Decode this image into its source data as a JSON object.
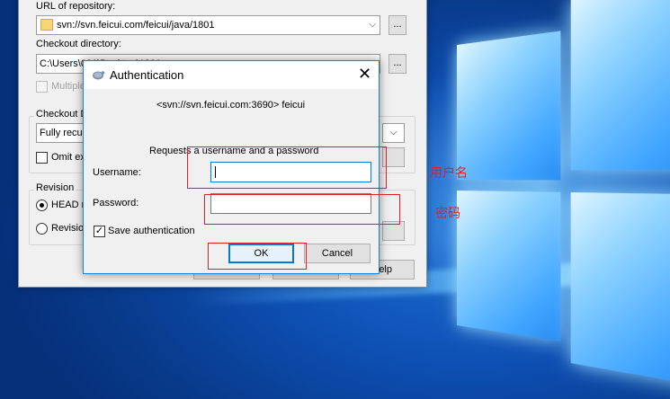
{
  "checkout": {
    "url_label": "URL of repository:",
    "url_value": "svn://svn.feicui.com/feicui/java/1801",
    "browse_button": "...",
    "dir_label": "Checkout directory:",
    "dir_value": "C:\\Users\\001\\Desktop\\1801",
    "multiple_label": "Multiple",
    "depth_label": "Checkout D",
    "depth_value": "Fully recur",
    "omit_label": "Omit ex",
    "revision_label": "Revision",
    "head_label": "HEAD re",
    "revision_opt_label": "Revision",
    "help_button": "elp"
  },
  "auth": {
    "title": "Authentication",
    "close_glyph": "✕",
    "realm": "<svn://svn.feicui.com:3690> feicui",
    "message": "Requests a username and a password",
    "username_label": "Username:",
    "username_value": "",
    "password_label": "Password:",
    "password_value": "",
    "save_label": "Save authentication",
    "save_checked": true,
    "check_glyph": "✓",
    "ok_button": "OK",
    "cancel_button": "Cancel"
  },
  "annotations": {
    "username_note": "用户名",
    "password_note": "密码"
  },
  "colors": {
    "annotation": "#e02020",
    "focus": "#0078d7"
  }
}
